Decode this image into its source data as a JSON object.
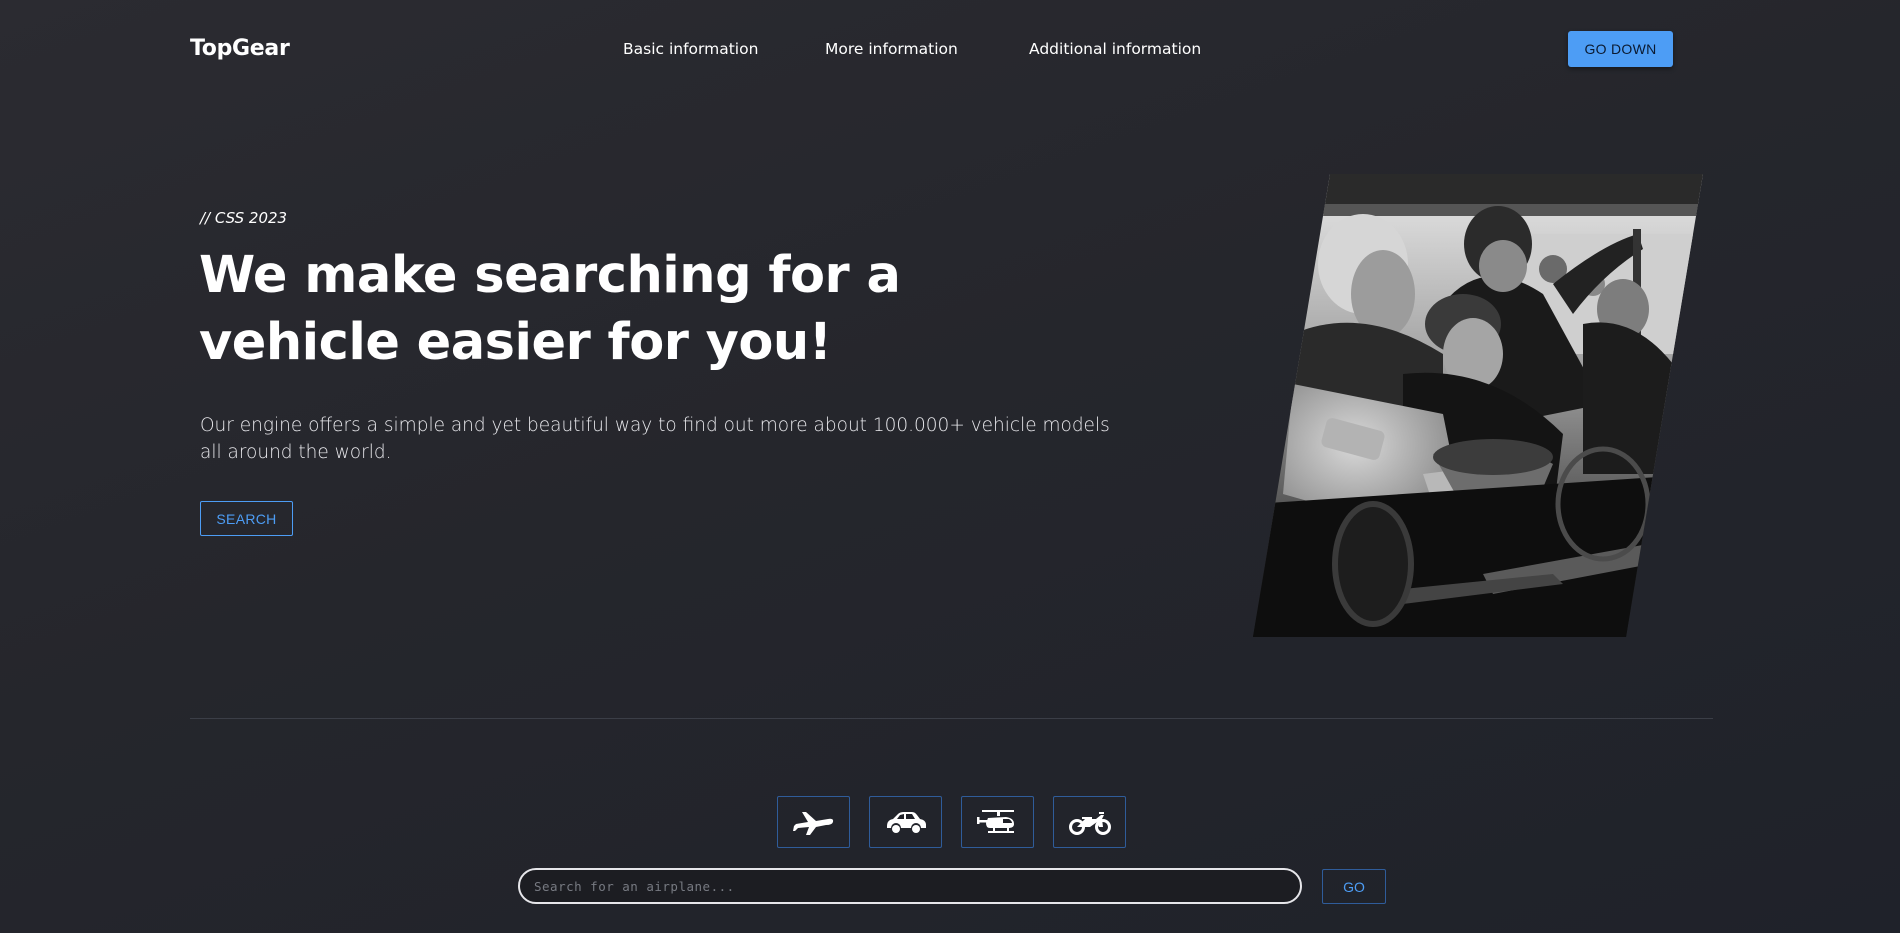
{
  "header": {
    "logo": "TopGear",
    "nav": [
      {
        "label": "Basic information"
      },
      {
        "label": "More information"
      },
      {
        "label": "Additional information"
      }
    ],
    "cta_label": "GO DOWN"
  },
  "hero": {
    "eyebrow": "// CSS 2023",
    "headline": "We make searching for a vehicle easier for you!",
    "lead": "Our engine offers a simple and yet beautiful way to find out more about 100.000+ vehicle models all around the world.",
    "search_label": "SEARCH",
    "image_icon": "mechanics-photo"
  },
  "vehicles": {
    "tabs": [
      {
        "icon": "airplane-icon"
      },
      {
        "icon": "car-icon"
      },
      {
        "icon": "helicopter-icon"
      },
      {
        "icon": "motorcycle-icon"
      }
    ],
    "search_placeholder": "Search for an airplane...",
    "go_label": "GO"
  },
  "colors": {
    "accent": "#4d9df5",
    "background": "#26272d",
    "border_blue": "#2f5c9a"
  }
}
